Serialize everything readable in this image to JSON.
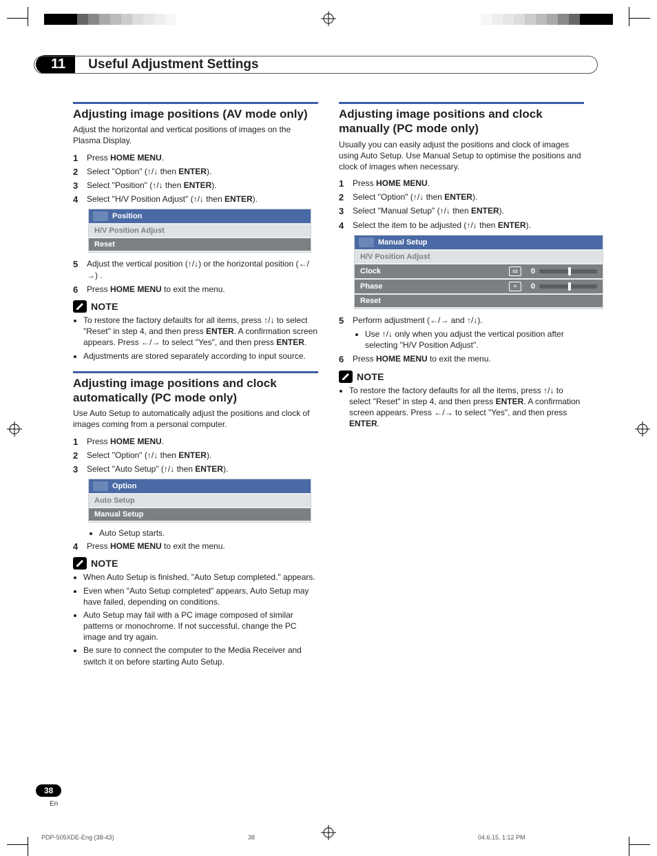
{
  "chapter": {
    "num": "11",
    "title": "Useful Adjustment Settings"
  },
  "section1": {
    "title": "Adjusting image positions (AV mode only)",
    "lead": "Adjust the horizontal and vertical positions of images on the Plasma Display.",
    "steps": {
      "s1a": "Press ",
      "s1b": "HOME MENU",
      "s1c": ".",
      "s2a": "Select \"Option\" (",
      "s2enter": "ENTER",
      "s2z": ").",
      "s3a": "Select \"Position\" (",
      "s3enter": "ENTER",
      "s3z": ").",
      "s4a": "Select \"H/V Position Adjust\" (",
      "s4enter": "ENTER",
      "s4z": ").",
      "s5": "Adjust the vertical position (↑/↓) or the horizontal position (←/→) .",
      "s6a": "Press ",
      "s6b": "HOME MENU",
      "s6c": " to exit the menu."
    },
    "osd": {
      "title": "Position",
      "row1": "H/V Position Adjust",
      "row2": "Reset"
    },
    "note_label": "NOTE",
    "notes": {
      "n1a": "To restore the factory defaults for all items, press ↑/↓ to select \"Reset\" in step 4, and then press ",
      "n1b": "ENTER",
      "n1c": ". A confirmation screen appears. Press ←/→ to select \"Yes\", and then press ",
      "n1d": "ENTER",
      "n1e": ".",
      "n2": "Adjustments are stored separately according to input source."
    }
  },
  "section2": {
    "title": "Adjusting image positions and clock automatically (PC mode only)",
    "lead": "Use Auto Setup to automatically adjust the positions and clock of images coming from a personal computer.",
    "steps": {
      "s1a": "Press ",
      "s1b": "HOME MENU",
      "s1c": ".",
      "s2a": "Select \"Option\" (",
      "s2enter": "ENTER",
      "s2z": ").",
      "s3a": "Select \"Auto Setup\" (",
      "s3enter": "ENTER",
      "s3z": ").",
      "bullet": "Auto Setup starts.",
      "s4a": "Press ",
      "s4b": "HOME MENU",
      "s4c": " to exit the menu."
    },
    "osd": {
      "title": "Option",
      "row1": "Auto Setup",
      "row2": "Manual Setup"
    },
    "note_label": "NOTE",
    "notes": {
      "n1": "When Auto Setup is finished, \"Auto Setup completed.\" appears.",
      "n2": "Even when \"Auto Setup completed\" appears, Auto Setup may have failed, depending on conditions.",
      "n3": "Auto Setup may fail with a PC image composed of similar patterns or monochrome. If not successful, change the PC image and try again.",
      "n4": "Be sure to connect the computer to the Media Receiver and switch it on before starting Auto Setup."
    }
  },
  "section3": {
    "title": "Adjusting image positions and clock manually (PC mode only)",
    "lead": "Usually you can easily adjust the positions and clock of images using Auto Setup. Use Manual Setup to optimise the positions and clock of images when necessary.",
    "steps": {
      "s1a": "Press ",
      "s1b": "HOME MENU",
      "s1c": ".",
      "s2a": "Select \"Option\" (",
      "s2enter": "ENTER",
      "s2z": ").",
      "s3a": "Select \"Manual Setup\" (",
      "s3enter": "ENTER",
      "s3z": ").",
      "s4a": "Select the item to be adjusted (",
      "s4enter": "ENTER",
      "s4z": ").",
      "s5": "Perform adjustment (←/→ and ↑/↓).",
      "s5b": "Use ↑/↓ only when you adjust the vertical position after selecting \"H/V Position Adjust\".",
      "s6a": "Press ",
      "s6b": "HOME MENU",
      "s6c": " to exit the menu."
    },
    "osd": {
      "title": "Manual Setup",
      "row1": "H/V Position Adjust",
      "row2": "Clock",
      "row2val": "0",
      "row3": "Phase",
      "row3val": "0",
      "row4": "Reset"
    },
    "note_label": "NOTE",
    "notes": {
      "n1a": "To restore the factory defaults for all the items, press ↑/↓ to select \"Reset\" in step 4, and then press ",
      "n1b": "ENTER",
      "n1c": ". A confirmation screen appears. Press ←/→ to select \"Yes\", and then press ",
      "n1d": "ENTER",
      "n1e": "."
    }
  },
  "arrows": {
    "ud": "↑/↓",
    "then": " then "
  },
  "footer": {
    "pagenum": "38",
    "lang": "En",
    "imprint_doc": "PDP-505XDE-Eng (38-43)",
    "imprint_page": "38",
    "imprint_ts": "04.6.15, 1:12 PM"
  }
}
